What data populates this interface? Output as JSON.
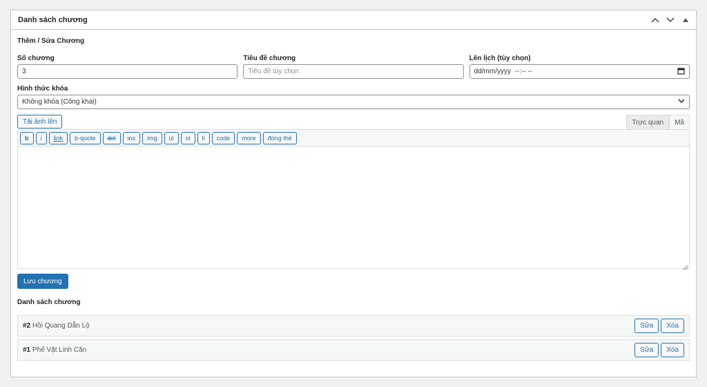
{
  "metabox": {
    "title": "Danh sách chương"
  },
  "form": {
    "section_title": "Thêm / Sửa Chương",
    "chapter_number": {
      "label": "Số chương",
      "value": "3"
    },
    "chapter_title": {
      "label": "Tiêu đề chương",
      "placeholder": "Tiêu đề tùy chọn"
    },
    "schedule": {
      "label": "Lên lịch (tùy chọn)",
      "value": "dd/mm/yyyy  --:-- --"
    },
    "lock_type": {
      "label": "Hình thức khóa",
      "selected": "Không khóa (Công khai)"
    }
  },
  "editor": {
    "upload_label": "Tải ảnh lên",
    "tab_visual": "Trực quan",
    "tab_code": "Mã",
    "quicktags": [
      "b",
      "i",
      "link",
      "b-quote",
      "del",
      "ins",
      "img",
      "ul",
      "ol",
      "li",
      "code",
      "more",
      "đóng thẻ"
    ]
  },
  "save_label": "Lưu chương",
  "list": {
    "title": "Danh sách chương",
    "items": [
      {
        "num": "#2",
        "name": "Hồi Quang Dẫn Lộ"
      },
      {
        "num": "#1",
        "name": "Phế Vật Linh Căn"
      }
    ],
    "edit_label": "Sửa",
    "delete_label": "Xóa"
  }
}
